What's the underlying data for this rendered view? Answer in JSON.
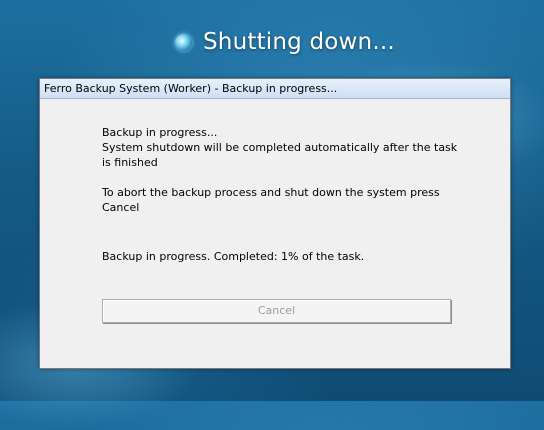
{
  "shutdown_screen": {
    "status_text": "Shutting down...",
    "spinner_icon": "busy-spinner-icon"
  },
  "dialog": {
    "title": "Ferro Backup System (Worker) - Backup in progress...",
    "message_lines": [
      "Backup in progress...",
      "System shutdown will be completed automatically after the task",
      "is finished",
      "To abort the backup process and shut down the system press",
      "Cancel"
    ],
    "progress_text": "Backup in progress. Completed: 1% of the task.",
    "progress_percent": 1,
    "cancel_label": "Cancel",
    "cancel_enabled": false
  },
  "colors": {
    "background": "#145a86",
    "dialog_background": "#f0f0f0",
    "titlebar": "#cfe0f4",
    "disabled_text": "#9d9d9d"
  }
}
